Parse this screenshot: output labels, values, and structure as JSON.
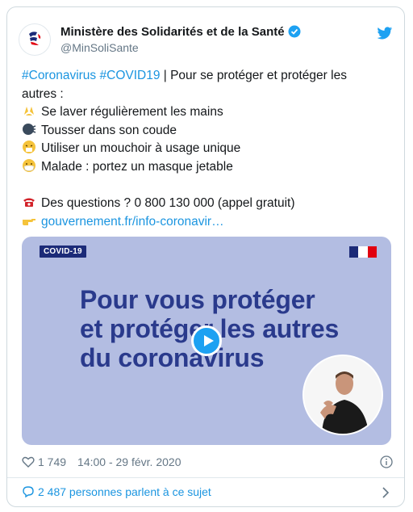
{
  "account": {
    "name": "Ministère des Solidarités et de la Santé",
    "handle": "@MinSoliSante"
  },
  "tweet": {
    "hashtag1": "#Coronavirus",
    "hashtag2": "#COVID19",
    "intro_rest": " | Pour se protéger et protéger les",
    "intro_line2": "autres :",
    "items": [
      {
        "icon": "washing-hands-icon",
        "text": "Se laver régulièrement les mains"
      },
      {
        "icon": "coughing-face-icon",
        "text": "Tousser dans son coude"
      },
      {
        "icon": "sneezing-face-icon",
        "text": "Utiliser un mouchoir à usage unique"
      },
      {
        "icon": "mask-face-icon",
        "text": "Malade : portez un masque jetable"
      }
    ],
    "phone_line": "Des questions ? 0 800 130 000 (appel gratuit)",
    "link": "gouvernement.fr/info-coronavir…"
  },
  "media": {
    "badge": "COVID-19",
    "headline": [
      "Pour vous protéger",
      "et protéger les autres",
      "du coronavirus"
    ]
  },
  "meta": {
    "likes": "1 749",
    "timestamp": "14:00 - 29 févr. 2020"
  },
  "footer": {
    "conversation": "2 487 personnes parlent à ce sujet"
  },
  "colors": {
    "link": "#1b95e0",
    "media_bg": "#b3bde2",
    "headline": "#2a3a8c",
    "twitter_blue": "#1da1f2"
  }
}
